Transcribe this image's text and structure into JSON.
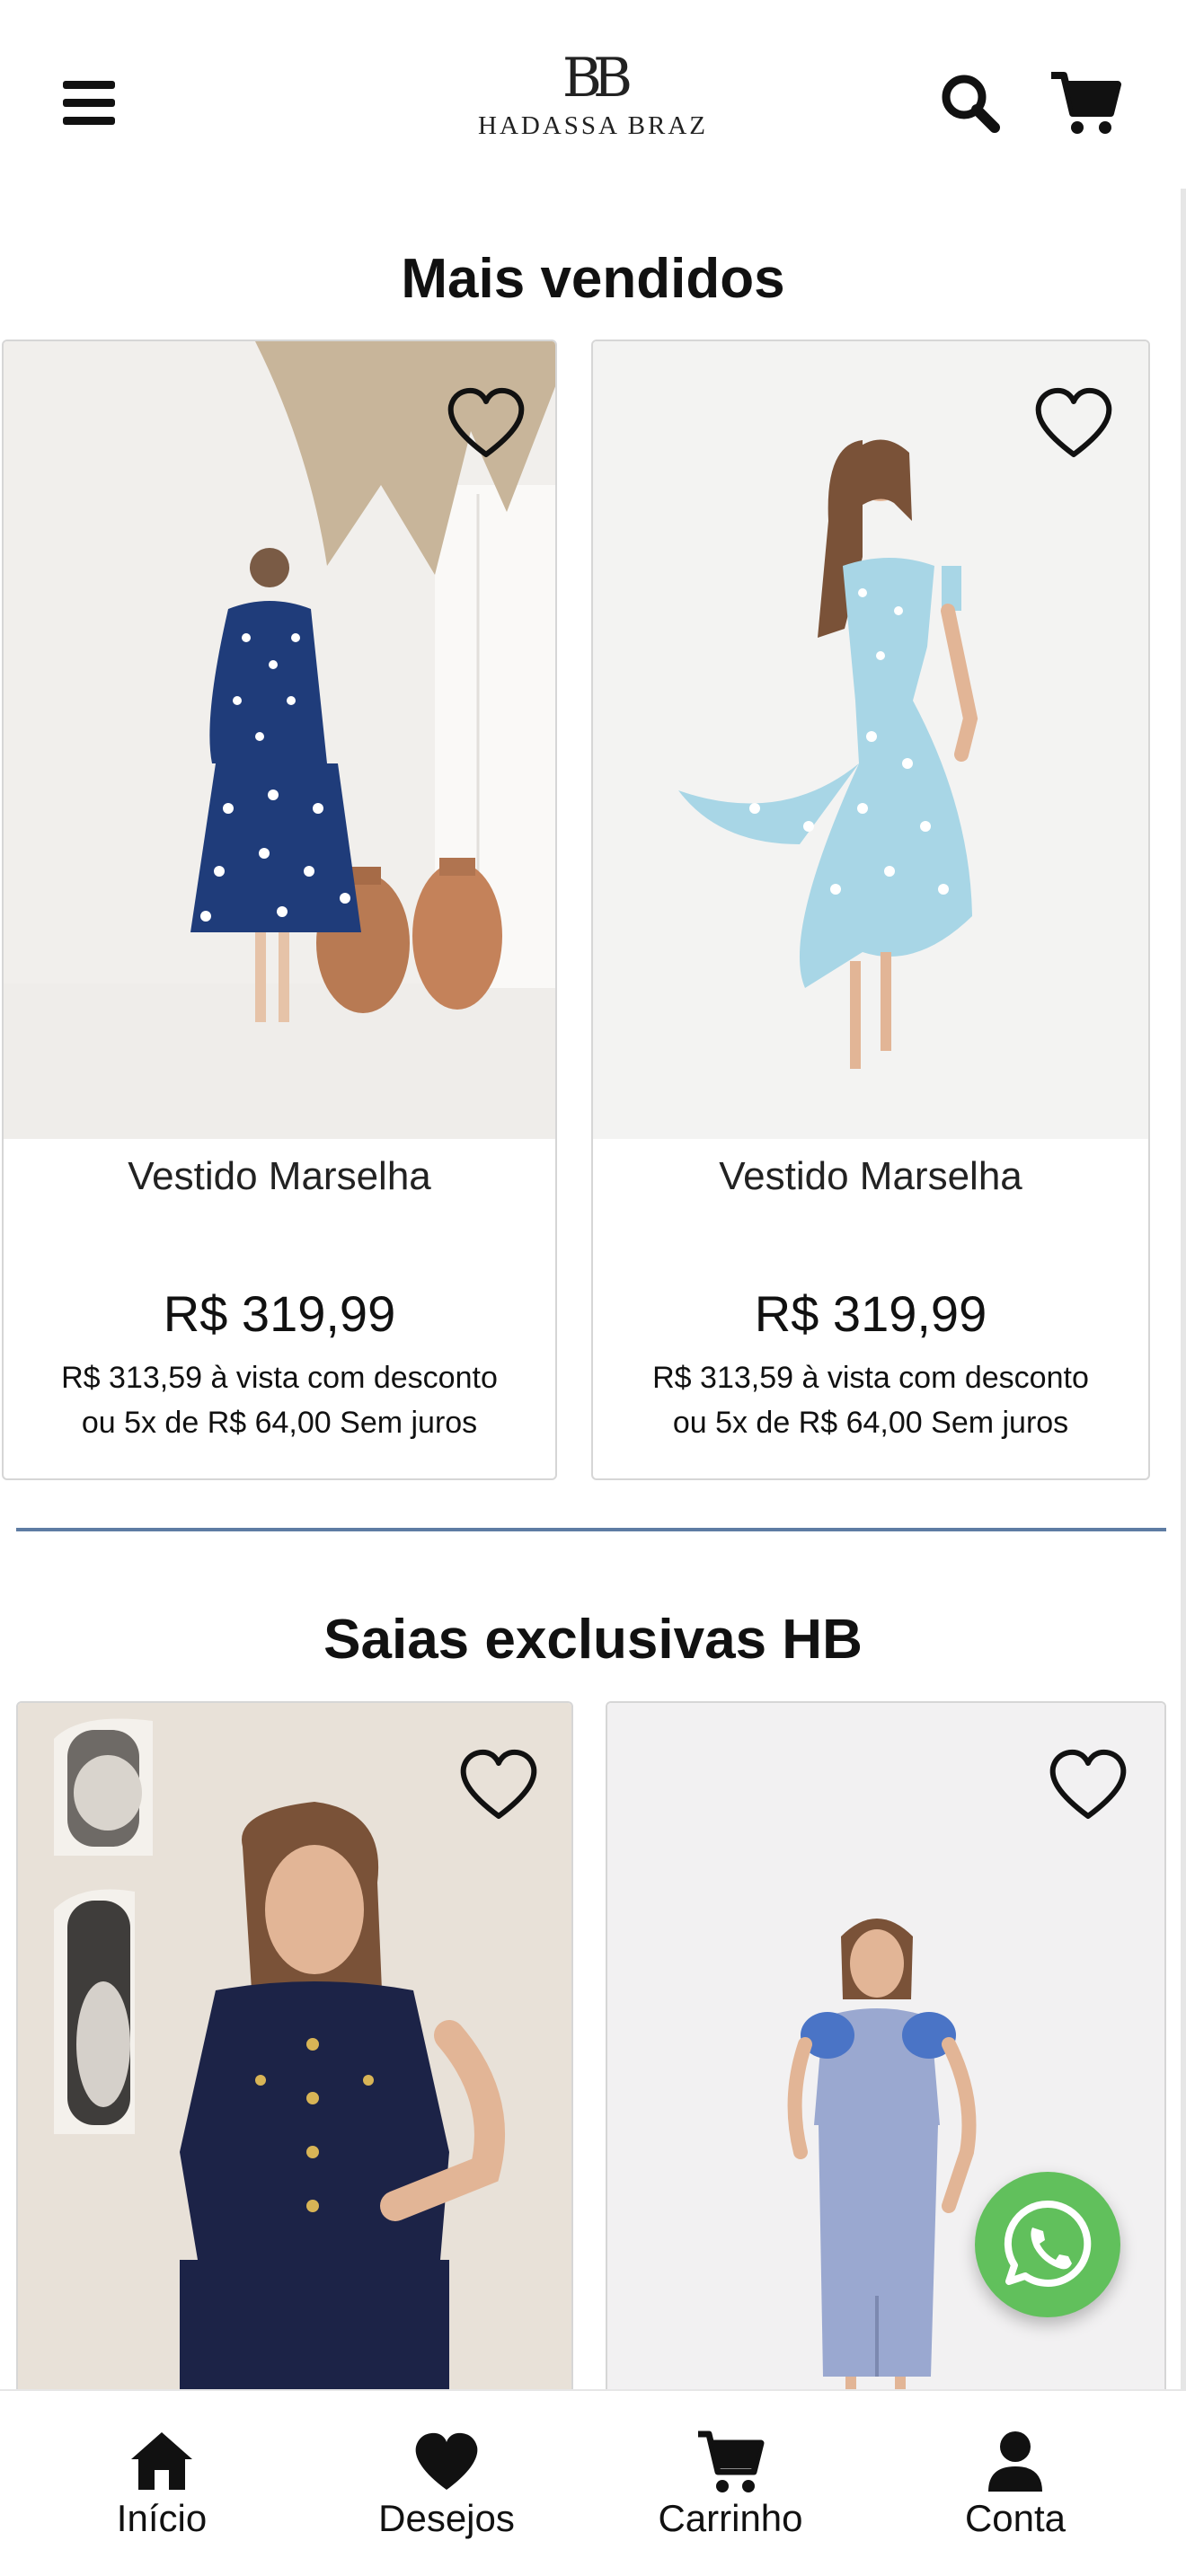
{
  "header": {
    "logo_mark": "BB",
    "logo_text": "HADASSA BRAZ"
  },
  "sections": [
    {
      "title": "Mais vendidos",
      "products": [
        {
          "name": "Vestido Marselha",
          "price": "R$ 319,99",
          "cash_price": "R$ 313,59 à vista com desconto",
          "installments": "ou 5x de R$ 64,00 Sem juros"
        },
        {
          "name": "Vestido Marselha",
          "price": "R$ 319,99",
          "cash_price": "R$ 313,59 à vista com desconto",
          "installments": "ou 5x de R$ 64,00 Sem juros"
        }
      ]
    },
    {
      "title": "Saias exclusivas HB",
      "products": []
    }
  ],
  "bottom_nav": [
    {
      "label": "Início",
      "icon": "home-icon"
    },
    {
      "label": "Desejos",
      "icon": "heart-icon"
    },
    {
      "label": "Carrinho",
      "icon": "cart-icon"
    },
    {
      "label": "Conta",
      "icon": "user-icon"
    }
  ],
  "colors": {
    "divider": "#5e7ca3",
    "whatsapp": "#61c05c"
  }
}
